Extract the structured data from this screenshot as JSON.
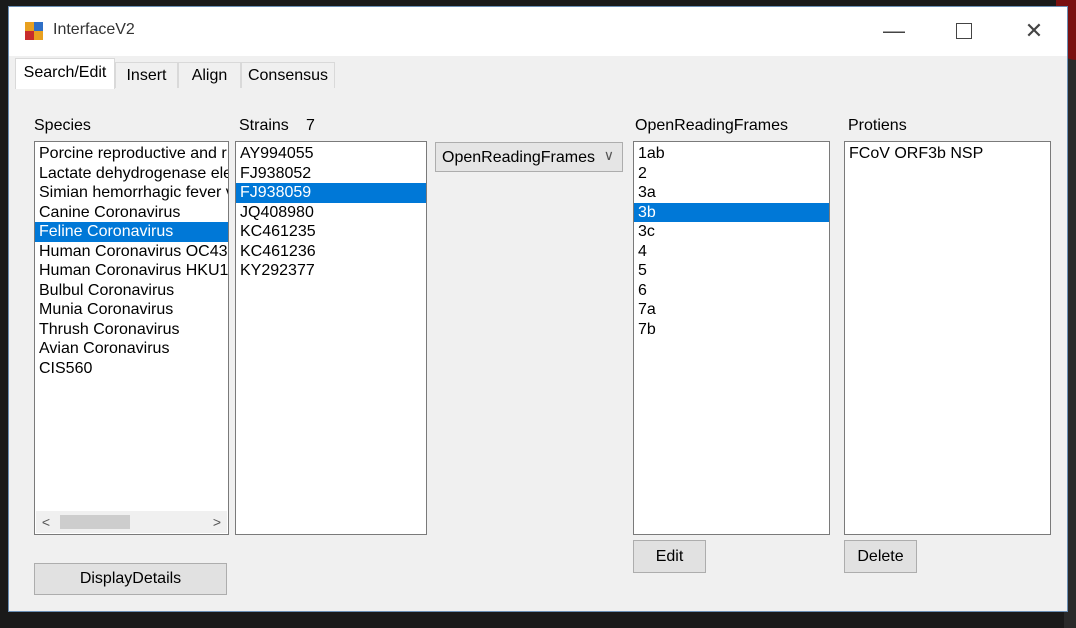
{
  "window": {
    "title": "InterfaceV2"
  },
  "tabs": [
    "Search/Edit",
    "Insert",
    "Align",
    "Consensus"
  ],
  "species": {
    "label": "Species",
    "items": [
      "Porcine reproductive and r",
      "Lactate dehydrogenase ele",
      "Simian hemorrhagic fever v",
      "Canine Coronavirus",
      "Feline Coronavirus",
      "Human Coronavirus OC43",
      "Human Coronavirus HKU1",
      "Bulbul Coronavirus",
      "Munia Coronavirus",
      "Thrush Coronavirus",
      "Avian Coronavirus",
      "CIS560"
    ],
    "selected_index": 4
  },
  "strains": {
    "label": "Strains",
    "count": "7",
    "items": [
      "AY994055",
      "FJ938052",
      "FJ938059",
      "JQ408980",
      "KC461235",
      "KC461236",
      "KY292377"
    ],
    "selected_index": 2
  },
  "dropdown": {
    "value": "OpenReadingFrames"
  },
  "orfs": {
    "label": "OpenReadingFrames",
    "items": [
      "1ab",
      "2",
      "3a",
      "3b",
      "3c",
      "4",
      "5",
      "6",
      "7a",
      "7b"
    ],
    "selected_index": 3
  },
  "proteins": {
    "label": "Protiens",
    "items": [
      "FCoV ORF3b NSP"
    ]
  },
  "buttons": {
    "display_details": "DisplayDetails",
    "edit": "Edit",
    "delete": "Delete"
  },
  "colors": {
    "selection": "#0078d7"
  }
}
